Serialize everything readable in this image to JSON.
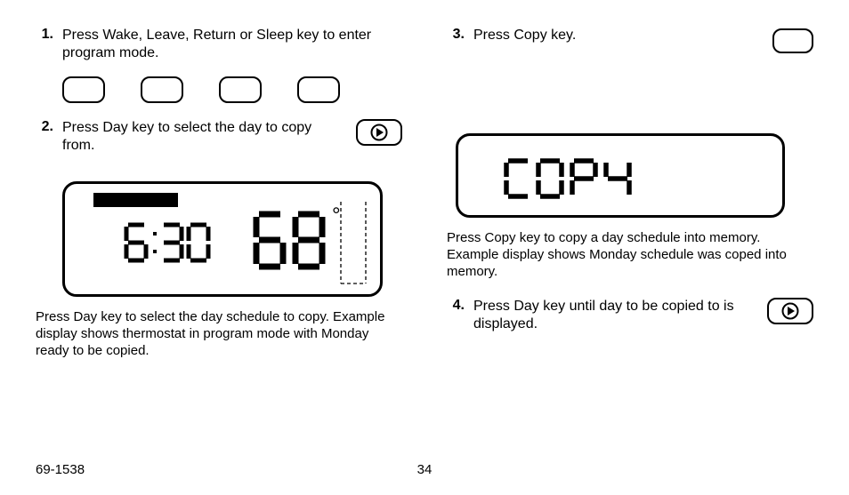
{
  "steps": {
    "s1": {
      "num": "1.",
      "text": "Press Wake, Leave, Return or Sleep key to enter program mode."
    },
    "s2": {
      "num": "2.",
      "text": "Press Day key to select the day to copy from."
    },
    "s3": {
      "num": "3.",
      "text": "Press Copy key."
    },
    "s4": {
      "num": "4.",
      "text": "Press Day key until day to be copied to is displayed."
    }
  },
  "captions": {
    "c1": "Press Day key to select the day schedule to copy. Example display shows thermostat in program mode with Monday ready to be copied.",
    "c2": "Press Copy key to copy a day schedule into memory. Example display shows Monday schedule was coped into memory."
  },
  "lcd": {
    "time": "6:30",
    "temp": "68",
    "degree": "°",
    "copy": "COPY"
  },
  "footer": {
    "docnum": "69-1538",
    "page": "34"
  }
}
